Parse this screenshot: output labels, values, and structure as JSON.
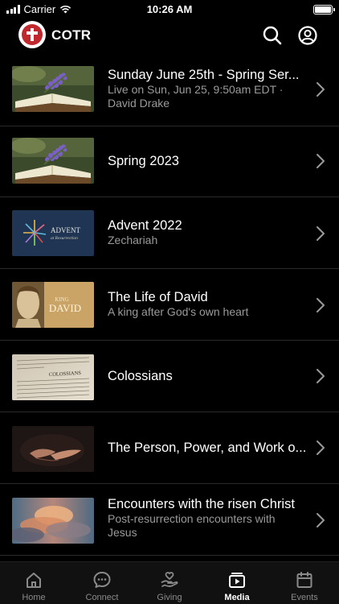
{
  "status_bar": {
    "carrier": "Carrier",
    "time": "10:26 AM"
  },
  "header": {
    "title": "COTR"
  },
  "media": [
    {
      "title": "Sunday June 25th - Spring Ser...",
      "subtitle": "Live on Sun, Jun 25, 9:50am EDT · David Drake",
      "thumbnail": "lavender-book"
    },
    {
      "title": "Spring 2023",
      "subtitle": "",
      "thumbnail": "lavender-book"
    },
    {
      "title": "Advent 2022",
      "subtitle": "Zechariah",
      "thumbnail": "advent"
    },
    {
      "title": "The Life of David",
      "subtitle": "A king after God's own heart",
      "thumbnail": "king-david"
    },
    {
      "title": "Colossians",
      "subtitle": "",
      "thumbnail": "bible-page"
    },
    {
      "title": "The Person, Power, and Work o...",
      "subtitle": "",
      "thumbnail": "hands"
    },
    {
      "title": "Encounters with the risen Christ",
      "subtitle": "Post-resurrection encounters with Jesus",
      "thumbnail": "sky"
    }
  ],
  "thumbnail_text": {
    "advent": {
      "line1": "ADVENT",
      "line2": "at Resurrection"
    },
    "david": {
      "line1": "KING",
      "line2": "DAVID"
    },
    "colossians": {
      "line1": "COLOSSIANS"
    }
  },
  "tabs": [
    {
      "label": "Home",
      "icon": "home-icon",
      "active": false
    },
    {
      "label": "Connect",
      "icon": "chat-icon",
      "active": false
    },
    {
      "label": "Giving",
      "icon": "giving-icon",
      "active": false
    },
    {
      "label": "Media",
      "icon": "media-icon",
      "active": true
    },
    {
      "label": "Events",
      "icon": "calendar-icon",
      "active": false
    }
  ],
  "colors": {
    "background": "#000000",
    "logo_red": "#c0282d",
    "tab_active": "#ffffff",
    "tab_inactive": "#8a8a8a",
    "subtitle": "#9a9a9a"
  }
}
